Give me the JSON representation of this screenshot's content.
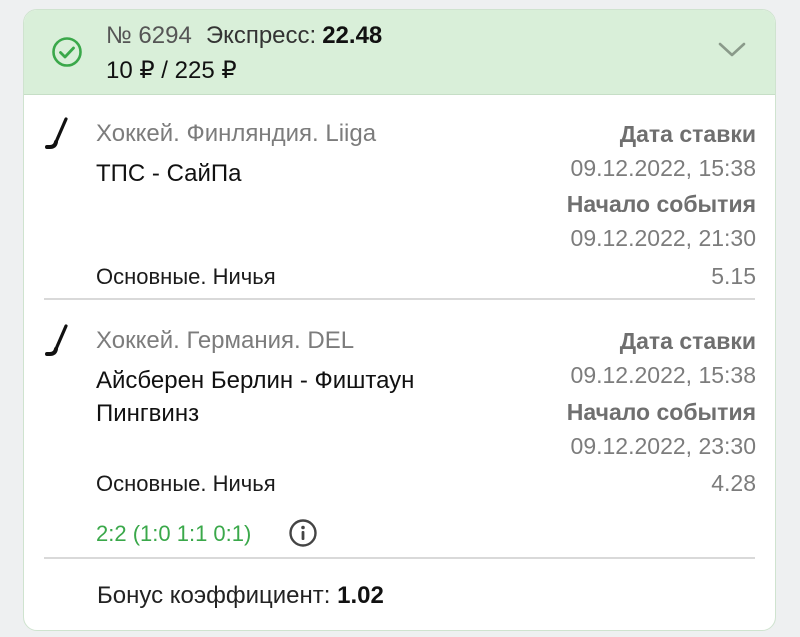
{
  "header": {
    "bet_number": "№ 6294",
    "bet_type": "Экспресс:",
    "total_odds": "22.48",
    "stake_payout": "10 ₽ / 225 ₽",
    "status_icon": "check-circle-icon",
    "expand_icon": "chevron-down-icon"
  },
  "events": [
    {
      "sport_icon": "hockey-stick-icon",
      "league": "Хоккей. Финляндия. Liiga",
      "teams": "ТПС - СайПа",
      "bet_date_label": "Дата ставки",
      "bet_date": "09.12.2022, 15:38",
      "start_label": "Начало события",
      "start_date": "09.12.2022, 21:30",
      "market": "Основные. Ничья",
      "odds": "5.15"
    },
    {
      "sport_icon": "hockey-stick-icon",
      "league": "Хоккей. Германия. DEL",
      "teams": "Айсберен Берлин - Фиштаун Пингвинз",
      "bet_date_label": "Дата ставки",
      "bet_date": "09.12.2022, 15:38",
      "start_label": "Начало события",
      "start_date": "09.12.2022, 23:30",
      "market": "Основные. Ничья",
      "odds": "4.28",
      "score": "2:2 (1:0 1:1 0:1)",
      "info_icon": "info-icon"
    }
  ],
  "bonus": {
    "label": "Бонус коэффициент:",
    "value": "1.02"
  },
  "colors": {
    "header_bg": "#d9efd9",
    "accent_green": "#3aa84a",
    "muted_text": "#7c7c7c"
  }
}
